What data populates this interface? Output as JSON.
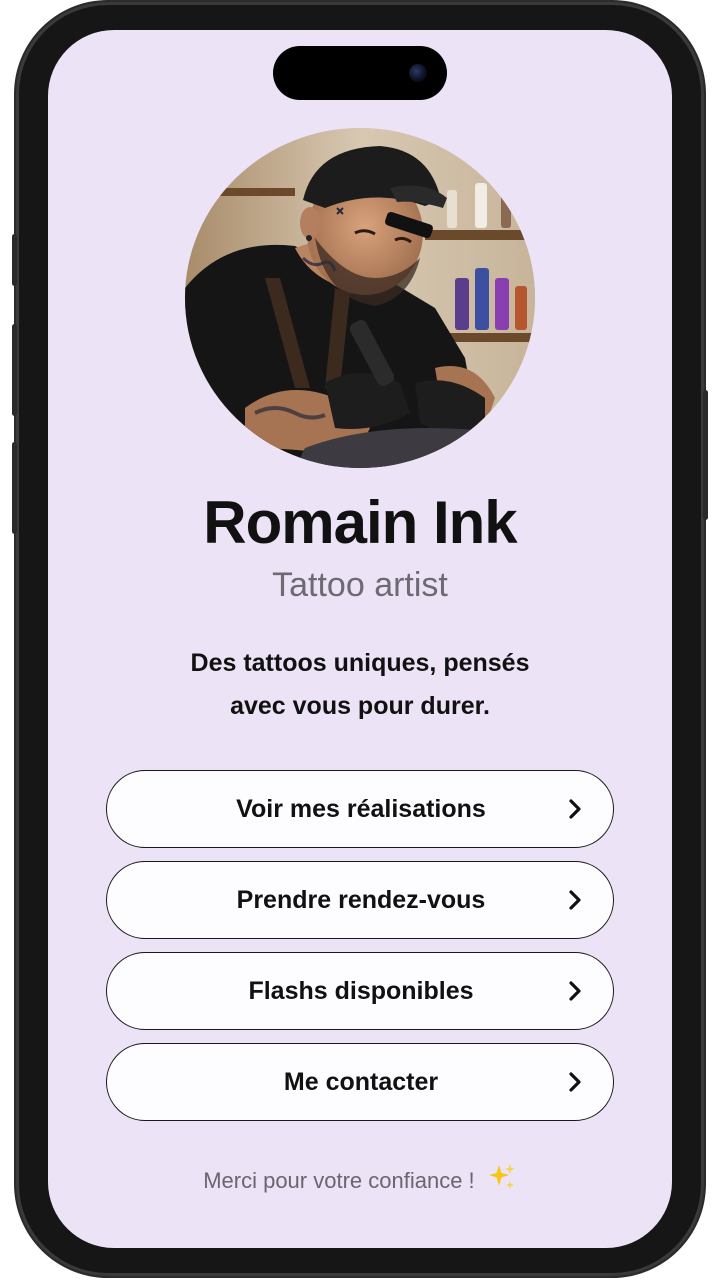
{
  "profile": {
    "name": "Romain Ink",
    "role": "Tattoo artist",
    "tagline_line1": "Des tattoos uniques, pensés",
    "tagline_line2": "avec vous pour durer.",
    "avatar_icon": "tattoo-artist-photo"
  },
  "links": [
    {
      "label": "Voir mes réalisations",
      "icon": "chevron-right-icon"
    },
    {
      "label": "Prendre rendez-vous",
      "icon": "chevron-right-icon"
    },
    {
      "label": "Flashs disponibles",
      "icon": "chevron-right-icon"
    },
    {
      "label": "Me contacter",
      "icon": "chevron-right-icon"
    }
  ],
  "footer": {
    "text": "Merci pour votre confiance !",
    "icon": "sparkles-icon"
  },
  "colors": {
    "background": "#ece3f6",
    "text": "#111111",
    "muted": "#6e6a73",
    "button_bg": "#fdfcfe",
    "button_border": "#1a1a1a"
  }
}
